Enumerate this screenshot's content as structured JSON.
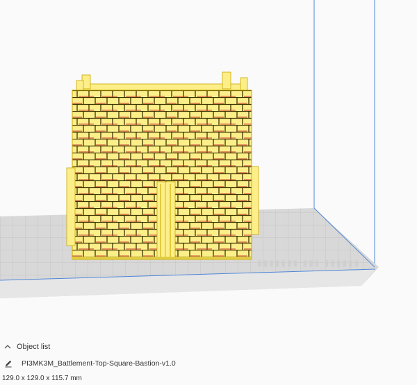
{
  "object_list": {
    "title": "Object list",
    "object_name": "PI3MK3M_Battlement-Top-Square-Bastion-v1.0",
    "dimensions": "129.0 x 129.0 x 115.7 mm"
  },
  "icons": {
    "collapse": "chevron-up-icon",
    "edit": "pencil-icon"
  },
  "colors": {
    "model": "#fcef8a",
    "model_shadow": "#c8a800",
    "overhang": "#c43a2a",
    "build_plate": "#d6d6d6",
    "grid_line": "#b8b8b8",
    "build_volume": "#4f86d8"
  }
}
